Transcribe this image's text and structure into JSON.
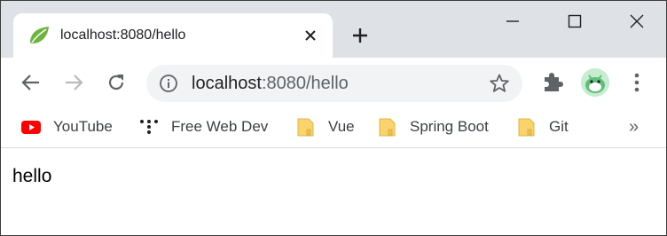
{
  "tab": {
    "title": "localhost:8080/hello"
  },
  "address_bar": {
    "host": "localhost",
    "rest": ":8080/hello"
  },
  "bookmarks": [
    {
      "label": "YouTube",
      "icon": "youtube-icon"
    },
    {
      "label": "Free Web Dev",
      "icon": "dots-logo-icon"
    },
    {
      "label": "Vue",
      "icon": "folder-icon"
    },
    {
      "label": "Spring Boot",
      "icon": "folder-icon"
    },
    {
      "label": "Git",
      "icon": "folder-icon"
    }
  ],
  "bookmarks_more": "»",
  "page": {
    "text": "hello"
  },
  "colors": {
    "tabstrip": "#dee1e6",
    "omnibox": "#f1f3f4",
    "spring_green": "#6db33f",
    "youtube_red": "#ff0000",
    "folder_yellow": "#f9d36b"
  }
}
